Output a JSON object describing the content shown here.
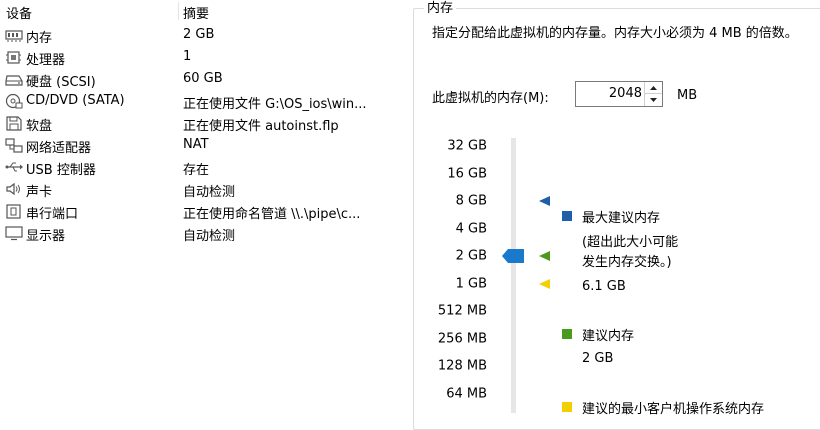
{
  "device_list": {
    "headers": {
      "device": "设备",
      "summary": "摘要"
    },
    "rows": [
      {
        "icon": "memory-icon",
        "name": "内存",
        "summary": "2 GB"
      },
      {
        "icon": "processor-icon",
        "name": "处理器",
        "summary": "1"
      },
      {
        "icon": "hard-disk-icon",
        "name": "硬盘 (SCSI)",
        "summary": "60 GB"
      },
      {
        "icon": "cd-dvd-icon",
        "name": "CD/DVD (SATA)",
        "summary": "正在使用文件 G:\\OS_ios\\win..."
      },
      {
        "icon": "floppy-icon",
        "name": "软盘",
        "summary": "正在使用文件 autoinst.flp"
      },
      {
        "icon": "network-adapter-icon",
        "name": "网络适配器",
        "summary": "NAT"
      },
      {
        "icon": "usb-icon",
        "name": "USB 控制器",
        "summary": "存在"
      },
      {
        "icon": "sound-card-icon",
        "name": "声卡",
        "summary": "自动检测"
      },
      {
        "icon": "serial-port-icon",
        "name": "串行端口",
        "summary": "正在使用命名管道 \\\\.\\pipe\\c..."
      },
      {
        "icon": "display-icon",
        "name": "显示器",
        "summary": "自动检测"
      }
    ]
  },
  "memory": {
    "group_title": "内存",
    "description": "指定分配给此虚拟机的内存量。内存大小必须为 4 MB 的倍数。",
    "vm_memory_label": "此虚拟机的内存(M):",
    "vm_memory_value": "2048",
    "unit": "MB",
    "scale": [
      "32 GB",
      "16 GB",
      "8 GB",
      "4 GB",
      "2 GB",
      "1 GB",
      "512 MB",
      "256 MB",
      "128 MB",
      "64 MB"
    ],
    "current_level": "2 GB",
    "markers": {
      "max_recommended": "8 GB",
      "recommended": "2 GB",
      "min_guest": "1 GB"
    },
    "legend": [
      {
        "key": "max",
        "color": "#1f5fa8",
        "title": "最大建议内存",
        "note": "(超出此大小可能\n发生内存交换。)",
        "value": "6.1 GB"
      },
      {
        "key": "rec",
        "color": "#4a9a1e",
        "title": "建议内存",
        "value": "2 GB"
      },
      {
        "key": "min",
        "color": "#f2d000",
        "title": "建议的最小客户机操作系统内存"
      }
    ]
  }
}
